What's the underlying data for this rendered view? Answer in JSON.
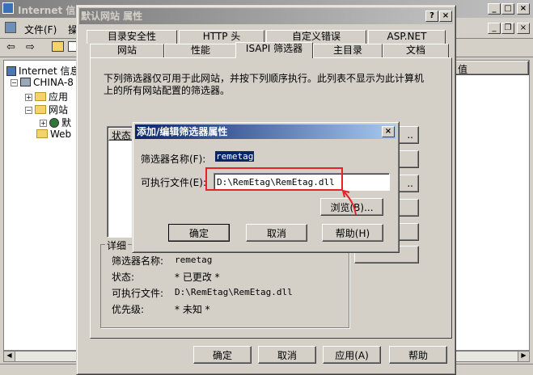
{
  "mmc": {
    "title": "Internet 信息",
    "menu": [
      "文件(F)",
      "操"
    ],
    "tree": [
      {
        "label": "Internet 信息"
      },
      {
        "label": "CHINA-8"
      },
      {
        "label": "应用"
      },
      {
        "label": "网站"
      },
      {
        "label": "默"
      },
      {
        "label": "Web"
      }
    ],
    "right_column_header": "值"
  },
  "props": {
    "title": "默认网站 属性",
    "tabs_row1": [
      "目录安全性",
      "HTTP 头",
      "自定义错误",
      "ASP.NET"
    ],
    "tabs_row2": [
      "网站",
      "性能",
      "ISAPI 筛选器",
      "主目录",
      "文档"
    ],
    "description": "下列筛选器仅可用于此网站，并按下列顺序执行。此列表不显示为此计算机上的所有网站配置的筛选器。",
    "list_header": "状态",
    "details": {
      "legend": "详细",
      "rows": [
        {
          "label": "筛选器名称:",
          "value": "remetag"
        },
        {
          "label": "状态:",
          "value": "* 已更改 *"
        },
        {
          "label": "可执行文件:",
          "value": "D:\\RemEtag\\RemEtag.dll"
        },
        {
          "label": "优先级:",
          "value": "* 未知 *"
        }
      ]
    },
    "buttons": {
      "ok": "确定",
      "cancel": "取消",
      "apply": "应用(A)",
      "help": "帮助"
    }
  },
  "modal": {
    "title": "添加/编辑筛选器属性",
    "name_label": "筛选器名称(F):",
    "name_value": "remetag",
    "exe_label": "可执行文件(E):",
    "exe_value": "D:\\RemEtag\\RemEtag.dll",
    "browse": "浏览(B)...",
    "ok": "确定",
    "cancel": "取消",
    "help": "帮助(H)"
  },
  "colors": {
    "annotation_red": "#e8202a",
    "selection_blue": "#0a246a"
  }
}
